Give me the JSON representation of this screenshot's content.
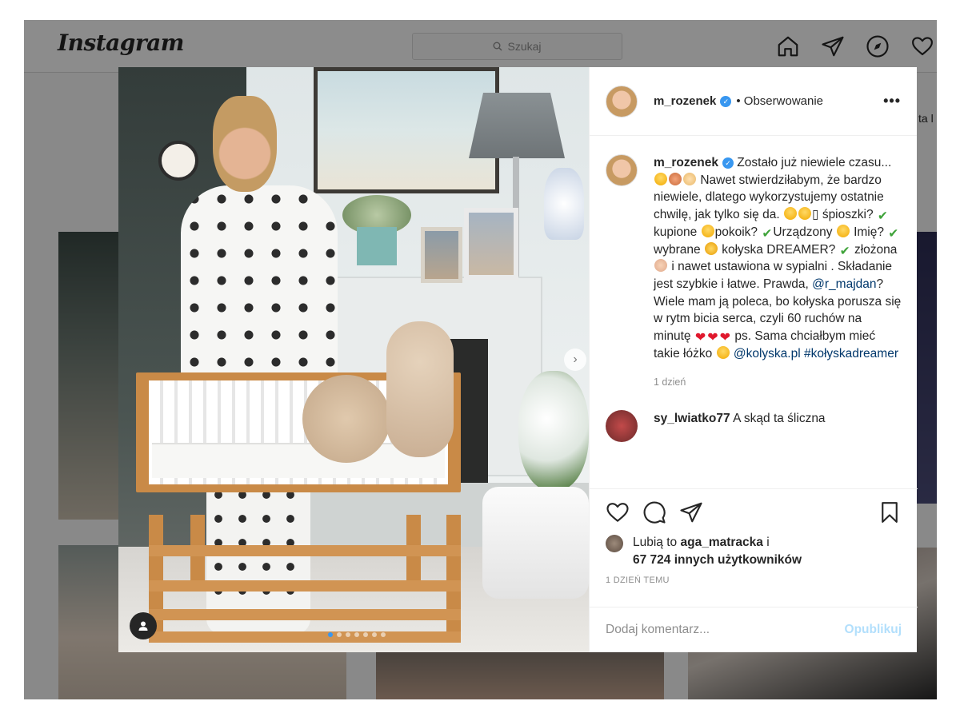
{
  "app": {
    "logo": "Instagram",
    "search_placeholder": "Szukaj"
  },
  "background": {
    "side_text": "ta l"
  },
  "post": {
    "author": "m_rozenek",
    "follow_label": "• Obserwowanie",
    "caption": {
      "username": "m_rozenek",
      "p1": "Zostało już niewiele czasu...",
      "p2": "Nawet stwierdziłabym, że bardzo niewiele, dlatego wykorzystujemy ostatnie chwilę, jak tylko się da.",
      "p3": "śpioszki?",
      "p4": "kupione",
      "p5": "pokoik?",
      "p6": "Urządzony",
      "p7": "Imię?",
      "p8": "wybrane",
      "p9": "kołyska DREAMER?",
      "p10": "złożona",
      "p11": "i nawet ustawiona w sypialni . Składanie jest szybkie i łatwe. Prawda,",
      "mention1": "@r_majdan",
      "p12": "? Wiele mam ją poleca, bo kołyska porusza się w rytm bicia serca, czyli 60 ruchów na minutę",
      "p13": "ps. Sama chciałbym mieć takie łóżko",
      "mention2": "@kolyska.pl",
      "hashtag": "#kołyskadreamer"
    },
    "caption_time": "1 dzień",
    "comment": {
      "username": "sy_lwiatko77",
      "text": "A skąd ta śliczna"
    },
    "likes": {
      "prefix": "Lubią to",
      "user": "aga_matracka",
      "conj": "i",
      "count": "67 724 innych użytkowników"
    },
    "date": "1 DZIEŃ TEMU",
    "comment_placeholder": "Dodaj komentarz...",
    "publish_label": "Opublikuj",
    "carousel_total": 7,
    "carousel_active": 0
  },
  "colors": {
    "verified": "#3897f0",
    "link": "#00376b",
    "publish_disabled": "#b2dffc"
  }
}
